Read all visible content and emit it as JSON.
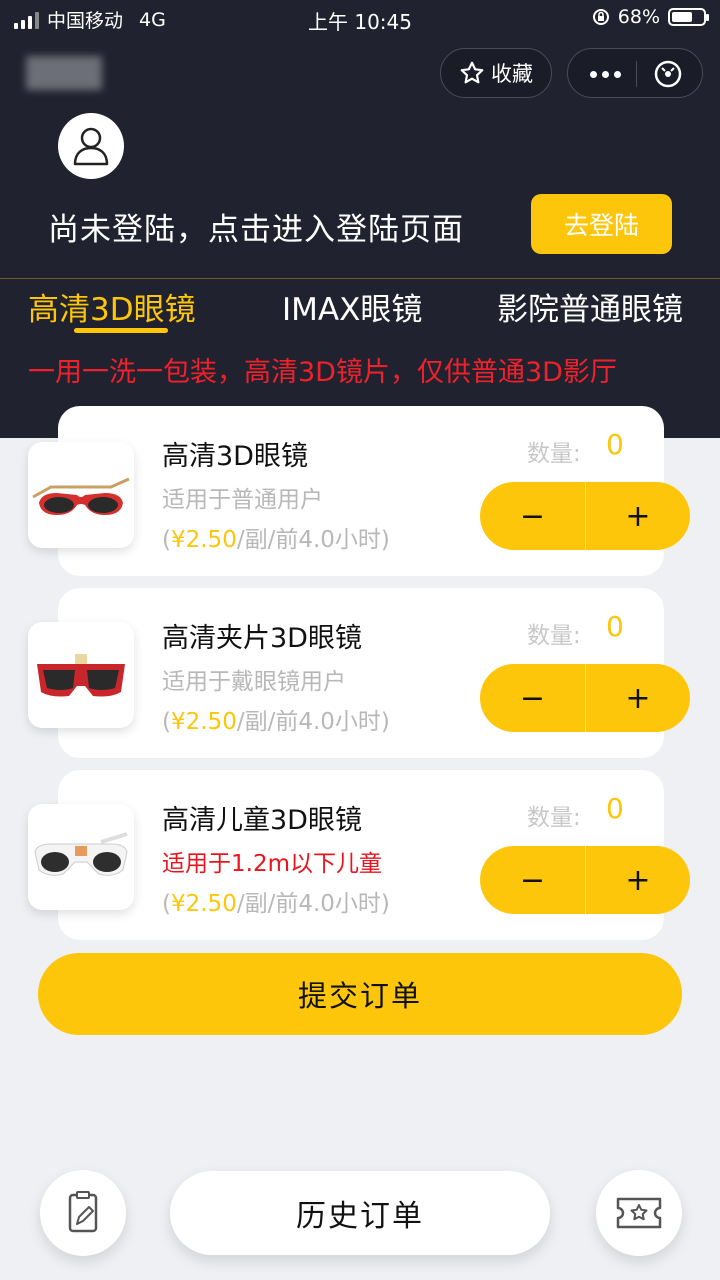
{
  "status_bar": {
    "carrier": "中国移动",
    "network": "4G",
    "time": "上午 10:45",
    "battery_level": "68%",
    "battery_fraction": 0.68
  },
  "capsule": {
    "favorite_label": "收藏"
  },
  "login": {
    "prompt": "尚未登陆，点击进入登陆页面",
    "button_label": "去登陆"
  },
  "tabs": [
    {
      "label": "高清3D眼镜",
      "active": true
    },
    {
      "label": "IMAX眼镜",
      "active": false
    },
    {
      "label": "影院普通眼镜",
      "active": false
    }
  ],
  "notice": "一用一洗一包装，高清3D镜片，仅供普通3D影厅",
  "products": [
    {
      "name": "高清3D眼镜",
      "desc": "适用于普通用户",
      "desc_highlight": false,
      "price_open": "(",
      "price_amount": "¥2.50",
      "price_unit": "/副/前4.0小时)",
      "qty_label": "数量:",
      "qty": "0",
      "icon": "red-gold-3d-glasses-image"
    },
    {
      "name": "高清夹片3D眼镜",
      "desc": "适用于戴眼镜用户",
      "desc_highlight": false,
      "price_open": "(",
      "price_amount": "¥2.50",
      "price_unit": "/副/前4.0小时)",
      "qty_label": "数量:",
      "qty": "0",
      "icon": "red-clip-on-3d-glasses-image"
    },
    {
      "name": "高清儿童3D眼镜",
      "desc": "适用于1.2m以下儿童",
      "desc_highlight": true,
      "price_open": "(",
      "price_amount": "¥2.50",
      "price_unit": "/副/前4.0小时)",
      "qty_label": "数量:",
      "qty": "0",
      "icon": "white-kids-3d-glasses-image"
    }
  ],
  "stepper": {
    "minus": "−",
    "plus": "+"
  },
  "submit_label": "提交订单",
  "bottom": {
    "history_label": "历史订单"
  },
  "colors": {
    "accent": "#fdc60b",
    "header_bg": "#20222f",
    "notice": "#f0212b",
    "page_bg": "#eef0f3"
  }
}
